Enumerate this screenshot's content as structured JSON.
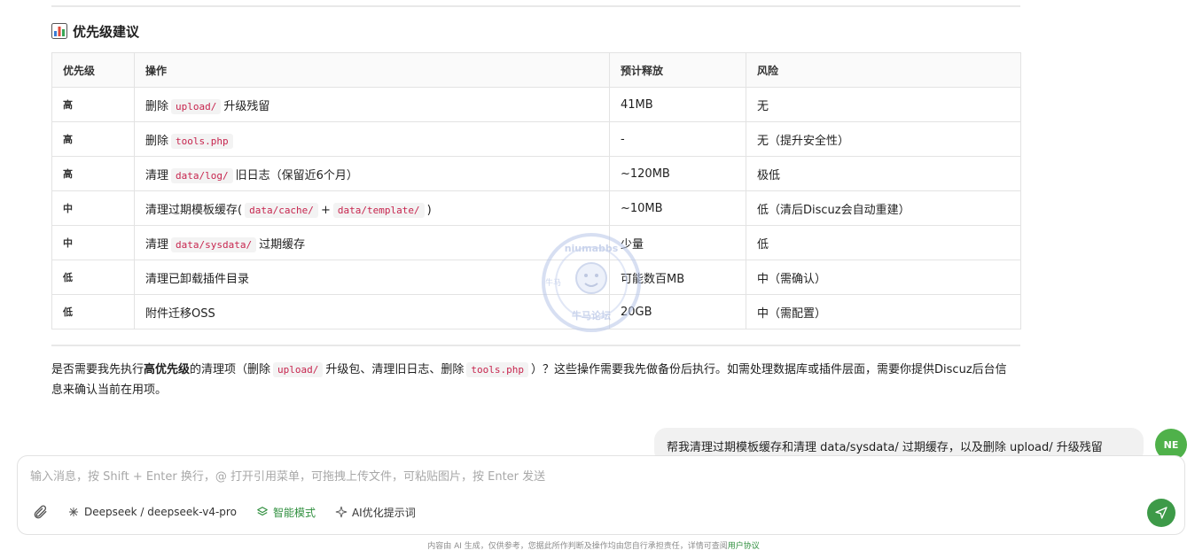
{
  "section": {
    "icon": "bar-chart-icon",
    "title": "优先级建议"
  },
  "table": {
    "headers": [
      "优先级",
      "操作",
      "预计释放",
      "风险"
    ],
    "rows": [
      {
        "level": "高",
        "parts": [
          {
            "t": "删除"
          },
          {
            "c": "upload/"
          },
          {
            "t": "升级残留"
          }
        ],
        "release": "41MB",
        "risk": "无"
      },
      {
        "level": "高",
        "parts": [
          {
            "t": "删除"
          },
          {
            "c": "tools.php"
          }
        ],
        "release": "-",
        "risk": "无（提升安全性）"
      },
      {
        "level": "高",
        "parts": [
          {
            "t": "清理"
          },
          {
            "c": "data/log/"
          },
          {
            "t": "旧日志（保留近6个月）"
          }
        ],
        "release": "~120MB",
        "risk": "极低"
      },
      {
        "level": "中",
        "parts": [
          {
            "t": "清理过期模板缓存("
          },
          {
            "c": "data/cache/"
          },
          {
            "t": "+"
          },
          {
            "c": "data/template/"
          },
          {
            "t": ")"
          }
        ],
        "release": "~10MB",
        "risk": "低（清后Discuz会自动重建）"
      },
      {
        "level": "中",
        "parts": [
          {
            "t": "清理"
          },
          {
            "c": "data/sysdata/"
          },
          {
            "t": "过期缓存"
          }
        ],
        "release": "少量",
        "risk": "低"
      },
      {
        "level": "低",
        "parts": [
          {
            "t": "清理已卸载插件目录"
          }
        ],
        "release": "可能数百MB",
        "risk": "中（需确认）"
      },
      {
        "level": "低",
        "parts": [
          {
            "t": "附件迁移OSS"
          }
        ],
        "release": "20GB",
        "risk": "中（需配置）"
      }
    ]
  },
  "paragraph": {
    "t1": "是否需要我先执行",
    "bold": "高优先级",
    "t2": "的清理项（删除",
    "c1": "upload/",
    "t3": "升级包、清理旧日志、删除",
    "c2": "tools.php",
    "t4": "）？这些操作需要我先做备份后执行。如需处理数据库或插件层面，需要你提供Discuz后台信息来确认当前在用项。"
  },
  "user_message": "帮我清理过期模板缓存和清理 data/sysdata/ 过期缓存，以及删除 upload/ 升级残留",
  "avatar_text": "NE",
  "watermark": {
    "top_text": "niumabbs",
    "bottom_text": "牛马论坛",
    "left_text": "牛马"
  },
  "composer": {
    "placeholder": "输入消息，按 Shift + Enter 换行，@ 打开引用菜单，可拖拽上传文件，可粘贴图片，按 Enter 发送",
    "attach_icon": "paperclip-icon",
    "model_label": "Deepseek / deepseek-v4-pro",
    "smart_label": "智能模式",
    "optimize_label": "AI优化提示词",
    "send_icon": "send-icon"
  },
  "footer": {
    "text": "内容由 AI 生成，仅供参考，您据此所作判断及操作均由您自行承担责任，详情可查阅",
    "link": "用户协议"
  },
  "colors": {
    "accent": "#3d9a48",
    "code": "#c7254e",
    "smart": "#2f8f3e"
  }
}
